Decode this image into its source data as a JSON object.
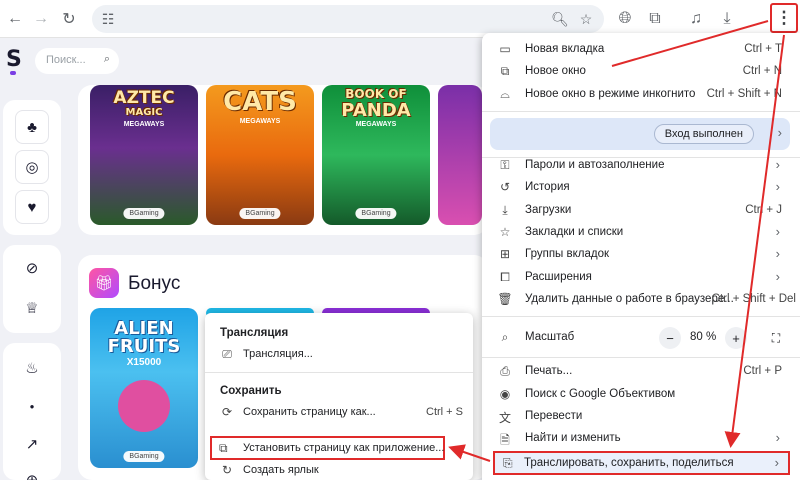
{
  "colors": {
    "annotation_red": "#e02a2a",
    "accent_purple": "#7b3fe4",
    "menu_highlight": "#dde7f8"
  },
  "toolbar": {
    "icons": [
      "back-arrow-icon",
      "forward-arrow-icon",
      "reload-icon",
      "site-settings-icon",
      "zoom-icon",
      "star-icon",
      "translate-icon",
      "extensions-icon",
      "media-icon",
      "download-icon",
      "kebab-menu-icon"
    ]
  },
  "site": {
    "logo": "S",
    "search_placeholder": "Поиск...",
    "bonus_section_title": "Бонус",
    "top_games": [
      {
        "title": "AZTEC",
        "subtitle": "MAGIC",
        "extra": "MEGAWAYS",
        "badge": "BGaming"
      },
      {
        "title": "CATS",
        "subtitle": "",
        "extra": "MEGAWAYS",
        "badge": "BGaming"
      },
      {
        "title": "BOOK OF",
        "subtitle": "PANDA",
        "extra": "MEGAWAYS",
        "badge": "BGaming"
      }
    ],
    "bonus_games": [
      {
        "title": "ALIEN",
        "subtitle": "FRUITS",
        "extra": "X15000",
        "badge": "BGaming"
      }
    ]
  },
  "menu": {
    "new_tab": {
      "label": "Новая вкладка",
      "shortcut": "Ctrl + T"
    },
    "new_window": {
      "label": "Новое окно",
      "shortcut": "Ctrl + N"
    },
    "incognito": {
      "label": "Новое окно в режиме инкогнито",
      "shortcut": "Ctrl + Shift + N"
    },
    "signed_in": "Вход выполнен",
    "passwords": {
      "label": "Пароли и автозаполнение"
    },
    "history": {
      "label": "История"
    },
    "downloads": {
      "label": "Загрузки",
      "shortcut": "Ctrl + J"
    },
    "bookmarks": {
      "label": "Закладки и списки"
    },
    "tab_groups": {
      "label": "Группы вкладок"
    },
    "extensions": {
      "label": "Расширения"
    },
    "clear_data": {
      "label": "Удалить данные о работе в браузере...",
      "shortcut": "Ctrl + Shift + Del"
    },
    "zoom": {
      "label": "Масштаб",
      "minus": "−",
      "value": "80 %",
      "plus": "+"
    },
    "print": {
      "label": "Печать...",
      "shortcut": "Ctrl + P"
    },
    "google_lens": {
      "label": "Поиск с Google Объективом"
    },
    "translate": {
      "label": "Перевести"
    },
    "find_edit": {
      "label": "Найти и изменить"
    },
    "cast_save_share": {
      "label": "Транслировать, сохранить, поделиться"
    }
  },
  "submenu": {
    "cast_header": "Трансляция",
    "cast_item": "Трансляция...",
    "save_header": "Сохранить",
    "save_page": {
      "label": "Сохранить страницу как...",
      "shortcut": "Ctrl + S"
    },
    "install_app": "Установить страницу как приложение...",
    "create_shortcut": "Создать ярлык"
  }
}
